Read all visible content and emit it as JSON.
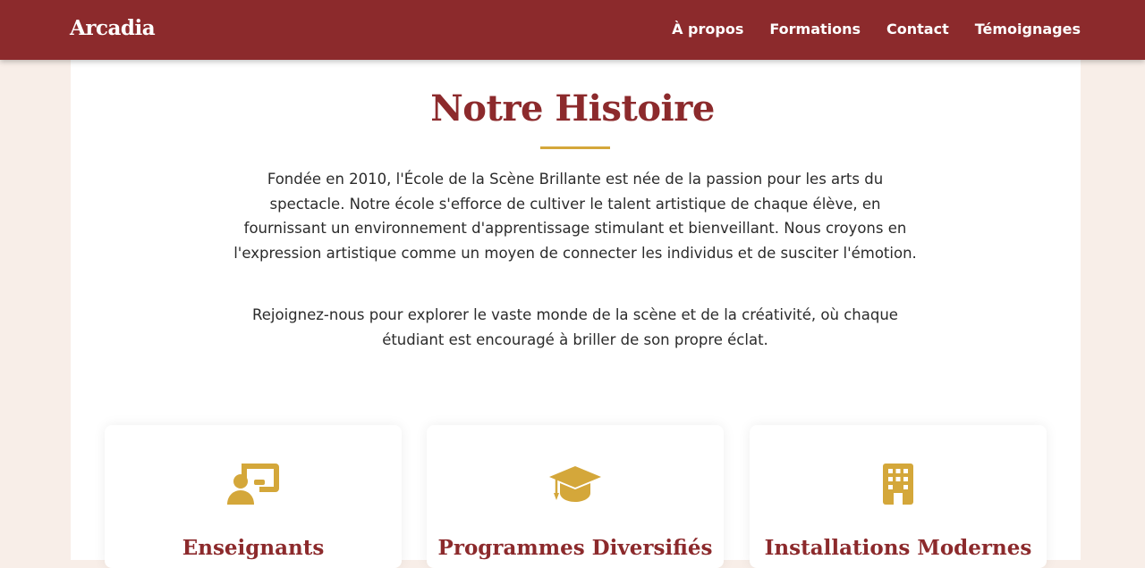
{
  "nav": {
    "brand": "Arcadia",
    "links": [
      {
        "label": "À propos"
      },
      {
        "label": "Formations"
      },
      {
        "label": "Contact"
      },
      {
        "label": "Témoignages"
      }
    ]
  },
  "about": {
    "title": "Notre Histoire",
    "paragraph_1": "Fondée en 2010, l'École de la Scène Brillante est née de la passion pour les arts du spectacle. Notre école s'efforce de cultiver le talent artistique de chaque élève, en fournissant un environnement d'apprentissage stimulant et bienveillant. Nous croyons en l'expression artistique comme un moyen de connecter les individus et de susciter l'émotion.",
    "paragraph_2": "Rejoignez-nous pour explorer le vaste monde de la scène et de la créativité, où chaque étudiant est encouragé à briller de son propre éclat."
  },
  "features": [
    {
      "icon": "teacher-board-icon",
      "title": "Enseignants"
    },
    {
      "icon": "graduation-cap-icon",
      "title": "Programmes Diversifiés"
    },
    {
      "icon": "building-icon",
      "title": "Installations Modernes"
    }
  ],
  "colors": {
    "primary": "#8c2a2c",
    "accent": "#d4a73a",
    "page_background": "#f8eee8"
  }
}
